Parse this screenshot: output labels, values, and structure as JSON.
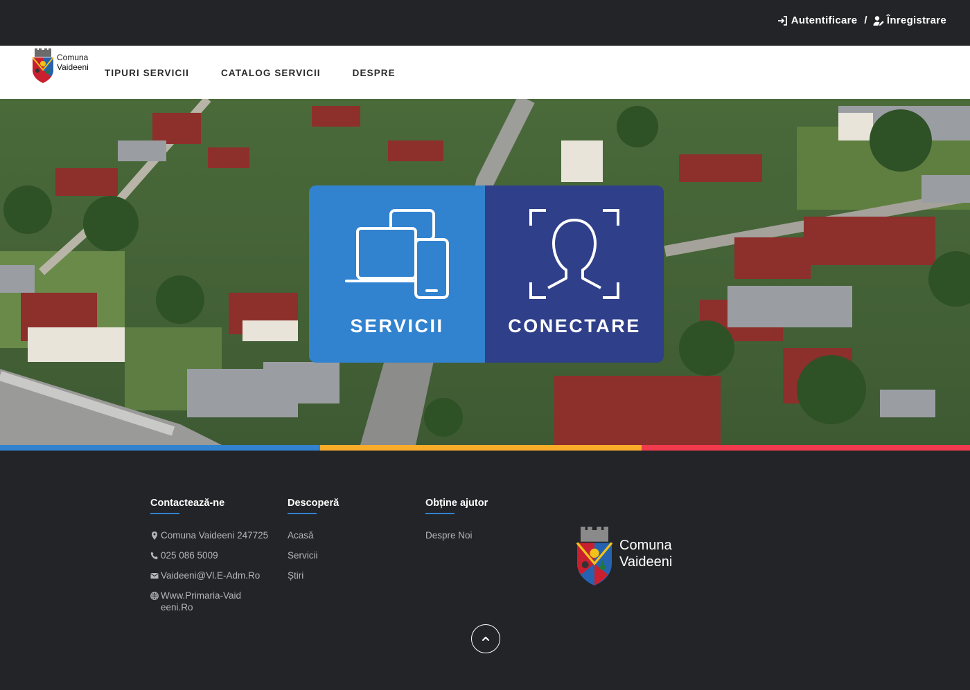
{
  "topbar": {
    "login_label": "Autentificare",
    "separator": "/",
    "register_label": "Înregistrare"
  },
  "brand": {
    "line1": "Comuna",
    "line2": "Vaideeni"
  },
  "nav": {
    "items": [
      {
        "label": "TIPURI SERVICII"
      },
      {
        "label": "CATALOG SERVICII"
      },
      {
        "label": "DESPRE"
      }
    ]
  },
  "hero": {
    "services_label": "SERVICII",
    "connect_label": "CONECTARE",
    "services_icon": "devices-icon",
    "connect_icon": "face-scan-icon"
  },
  "colors": {
    "dark": "#232428",
    "blue": "#3283cf",
    "navy": "#2f3f89",
    "yellow": "#f9ac2a",
    "red": "#f23a4e"
  },
  "footer": {
    "contact": {
      "title": "Contactează-ne",
      "address": "Comuna Vaideeni 247725",
      "phone": "025 086 5009",
      "email": "Vaideeni@Vl.E-Adm.Ro",
      "website": "Www.Primaria-Vaideeni.Ro"
    },
    "discover": {
      "title": "Descoperă",
      "items": [
        "Acasă",
        "Servicii",
        "Știri"
      ]
    },
    "help": {
      "title": "Obține ajutor",
      "items": [
        "Despre Noi"
      ]
    },
    "logo": {
      "line1": "Comuna",
      "line2": "Vaideeni"
    }
  }
}
